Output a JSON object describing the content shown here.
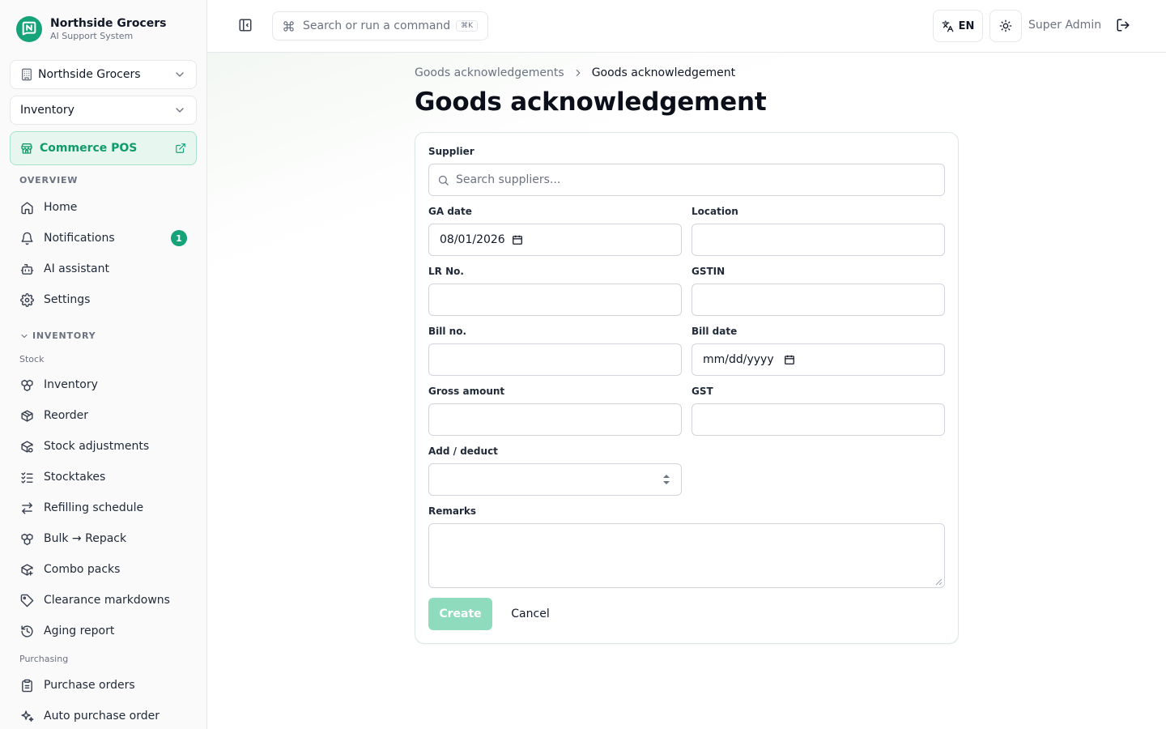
{
  "brand": {
    "name": "Northside Grocers",
    "subtitle": "AI Support System"
  },
  "sidebar": {
    "org_select": "Northside Grocers",
    "module_select": "Inventory",
    "pos_button": "Commerce POS",
    "overview_label": "OVERVIEW",
    "overview_items": [
      {
        "label": "Home",
        "icon": "home-icon"
      },
      {
        "label": "Notifications",
        "icon": "bell-icon",
        "badge": "1"
      },
      {
        "label": "AI assistant",
        "icon": "bot-icon"
      },
      {
        "label": "Settings",
        "icon": "gear-icon"
      }
    ],
    "inventory_label": "INVENTORY",
    "stock_label": "Stock",
    "stock_items": [
      {
        "label": "Inventory",
        "icon": "boxes-icon"
      },
      {
        "label": "Reorder",
        "icon": "package-icon"
      },
      {
        "label": "Stock adjustments",
        "icon": "package-cog-icon"
      },
      {
        "label": "Stocktakes",
        "icon": "list-checks-icon"
      },
      {
        "label": "Refilling schedule",
        "icon": "arrows-swap-icon"
      },
      {
        "label": "Bulk → Repack",
        "icon": "boxes-icon"
      },
      {
        "label": "Combo packs",
        "icon": "package-plus-icon"
      },
      {
        "label": "Clearance markdowns",
        "icon": "tag-icon"
      },
      {
        "label": "Aging report",
        "icon": "history-icon"
      }
    ],
    "purchasing_label": "Purchasing",
    "purchasing_items": [
      {
        "label": "Purchase orders",
        "icon": "clipboard-icon"
      },
      {
        "label": "Auto purchase order",
        "icon": "sparkles-icon"
      }
    ]
  },
  "topbar": {
    "search_placeholder": "Search or run a command",
    "search_shortcut": "⌘K",
    "language": "EN",
    "user_name": "Super Admin"
  },
  "breadcrumb": {
    "parent": "Goods acknowledgements",
    "current": "Goods acknowledgement"
  },
  "page_title": "Goods acknowledgement",
  "form": {
    "supplier_label": "Supplier",
    "supplier_placeholder": "Search suppliers...",
    "ga_date_label": "GA date",
    "ga_date_value": "08/01/2026",
    "location_label": "Location",
    "location_value": "",
    "lr_no_label": "LR No.",
    "lr_no_value": "",
    "gstin_label": "GSTIN",
    "gstin_value": "",
    "bill_no_label": "Bill no.",
    "bill_no_value": "",
    "bill_date_label": "Bill date",
    "bill_date_placeholder": "mm/dd/yyyy",
    "gross_amount_label": "Gross amount",
    "gross_amount_value": "",
    "gst_label": "GST",
    "gst_value": "",
    "add_deduct_label": "Add / deduct",
    "add_deduct_value": "",
    "remarks_label": "Remarks",
    "remarks_value": "",
    "create_label": "Create",
    "cancel_label": "Cancel"
  },
  "colors": {
    "accent": "#16a37a",
    "accent_soft_bg": "#e7f6ef",
    "create_disabled": "#8fdbbe"
  }
}
